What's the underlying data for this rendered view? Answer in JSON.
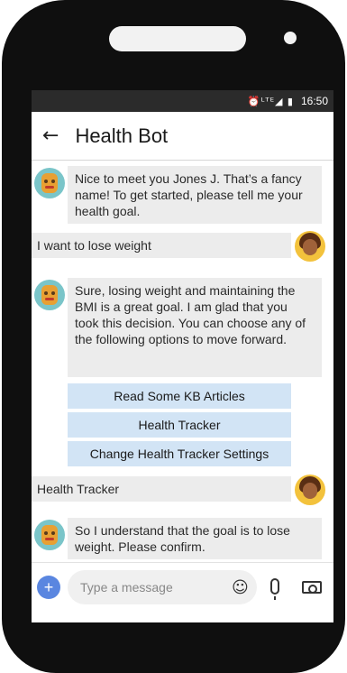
{
  "status": {
    "icons": "⏰ᴸᵀᴱ◢ ▮",
    "time": "16:50"
  },
  "header": {
    "back_icon": "arrow-left-icon",
    "title": "Health Bot"
  },
  "messages": [
    {
      "from": "bot",
      "text": "Nice to meet you Jones J. That’s a fancy name!  To get started, please tell me your health goal."
    },
    {
      "from": "user",
      "text": "I want to lose weight"
    },
    {
      "from": "bot",
      "text": "Sure, losing weight and maintaining the BMI is a great goal. I am glad that you took this decision. You can choose any of the following options to move forward."
    },
    {
      "from": "user",
      "text": "Health Tracker"
    },
    {
      "from": "bot",
      "text": "So I understand that the goal is to lose weight. Please confirm."
    }
  ],
  "options": [
    "Read Some KB Articles",
    "Health Tracker",
    "Change Health Tracker Settings"
  ],
  "input": {
    "placeholder": "Type a message"
  },
  "colors": {
    "accent": "#5a86e0",
    "option_bg": "#d2e4f5",
    "bubble_bg": "#ececec"
  }
}
